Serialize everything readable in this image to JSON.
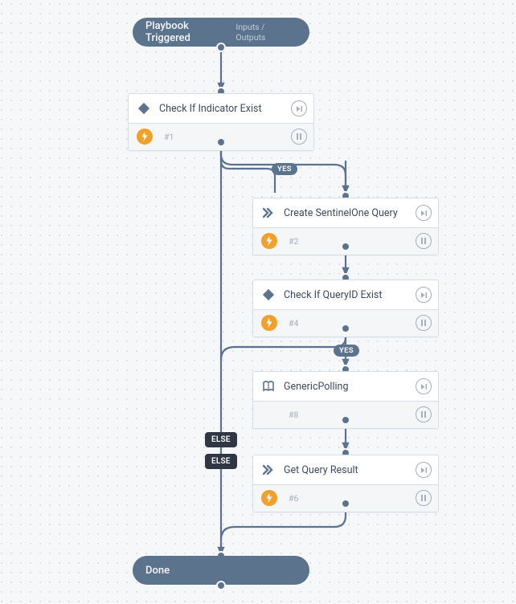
{
  "start": {
    "label": "Playbook Triggered",
    "sub": "Inputs / Outputs"
  },
  "end": {
    "label": "Done"
  },
  "nodes": {
    "n1": {
      "title": "Check If Indicator Exist",
      "idx": "#1",
      "type": "condition",
      "bolt": true
    },
    "n2": {
      "title": "Create SentinelOne Query",
      "idx": "#2",
      "type": "task",
      "bolt": true
    },
    "n4": {
      "title": "Check If QueryID Exist",
      "idx": "#4",
      "type": "condition",
      "bolt": true
    },
    "n8": {
      "title": "GenericPolling",
      "idx": "#8",
      "type": "playbook",
      "bolt": false
    },
    "n6": {
      "title": "Get Query Result",
      "idx": "#6",
      "type": "task",
      "bolt": true
    }
  },
  "edges": [
    {
      "from": "start",
      "to": "n1"
    },
    {
      "from": "n1",
      "to": "n2",
      "label": "YES"
    },
    {
      "from": "n1",
      "to": "end",
      "label": "ELSE"
    },
    {
      "from": "n2",
      "to": "n4"
    },
    {
      "from": "n4",
      "to": "n8",
      "label": "YES"
    },
    {
      "from": "n4",
      "to": "end",
      "label": "ELSE"
    },
    {
      "from": "n8",
      "to": "n6"
    },
    {
      "from": "n6",
      "to": "end"
    }
  ],
  "labels": {
    "yes1": "YES",
    "yes2": "YES",
    "else1": "ELSE",
    "else2": "ELSE"
  }
}
